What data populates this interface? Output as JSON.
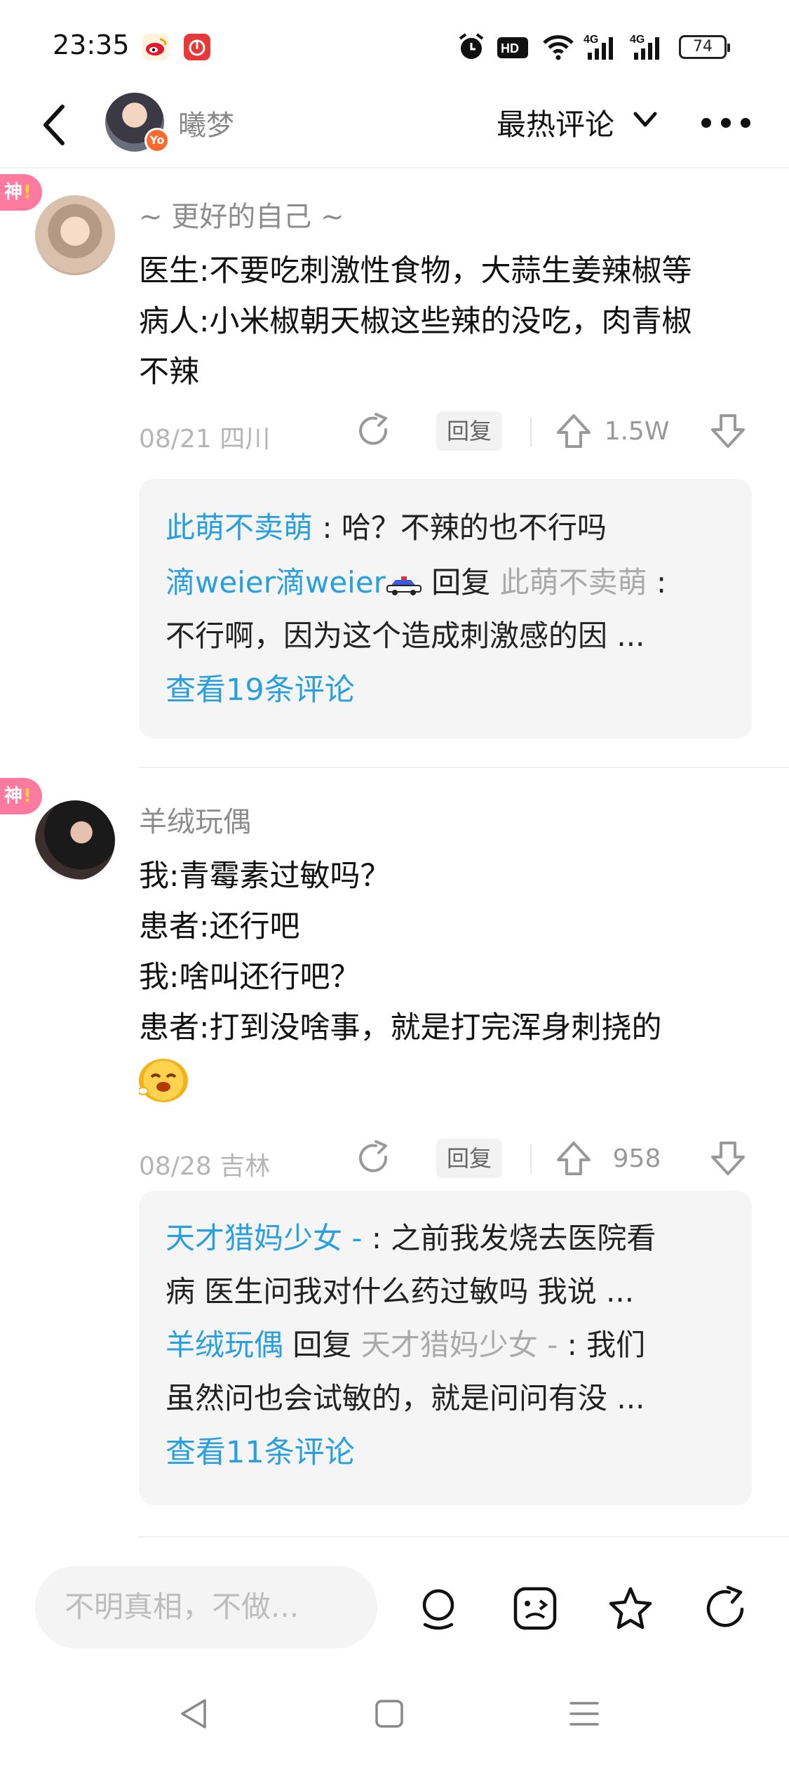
{
  "status_bar": {
    "time": "23:35",
    "battery": "74",
    "icons": [
      "weibo-icon",
      "netease-music-icon",
      "alarm-icon",
      "hd-icon",
      "wifi-icon",
      "signal-4g-icon",
      "signal-4g-icon"
    ]
  },
  "header": {
    "username": "曦梦",
    "avatar_badge": "Yo",
    "sort_label": "最热评论"
  },
  "comments": [
    {
      "badge": "神",
      "badge_mark": "!",
      "username": "~ 更好的自己 ~",
      "lines": [
        "医生:不要吃刺激性食物，大蒜生姜辣椒等",
        "病人:小米椒朝天椒这些辣的没吃，肉青椒",
        "不辣"
      ],
      "date_location": "08/21 四川",
      "reply_label": "回复",
      "likes": "1.5W",
      "replies": [
        {
          "user": "此萌不卖萌",
          "text": " : 哈？不辣的也不行吗"
        },
        {
          "user": "滴weier滴weier",
          "reply_word": " 回复 ",
          "target": "此萌不卖萌",
          "text": " :",
          "cont": "不行啊，因为这个造成刺激感的因 ..."
        }
      ],
      "view_more": "查看19条评论"
    },
    {
      "badge": "神",
      "badge_mark": "!",
      "username": "羊绒玩偶",
      "lines": [
        "我:青霉素过敏吗？",
        "患者:还行吧",
        "我:啥叫还行吧？",
        "患者:打到没啥事，就是打完浑身刺挠的"
      ],
      "date_location": "08/28 吉林",
      "reply_label": "回复",
      "likes": "958",
      "replies": [
        {
          "user": "天才猎妈少女 -",
          "text": " : 之前我发烧去医院看",
          "cont": "病 医生问我对什么药过敏吗 我说 ..."
        },
        {
          "user": "羊绒玩偶",
          "reply_word": " 回复 ",
          "target": "天才猎妈少女 -",
          "text": " :  我们",
          "cont": "虽然问也会试敏的，就是问问有没 ..."
        }
      ],
      "view_more": "查看11条评论"
    }
  ],
  "bottom_bar": {
    "input_placeholder": "不明真相，不做...",
    "icons": [
      "voice-icon",
      "emoji-icon",
      "favorite-star-icon",
      "share-icon"
    ]
  },
  "nav_bar": {
    "icons": [
      "back-triangle-icon",
      "home-square-icon",
      "menu-lines-icon"
    ]
  },
  "colors": {
    "link_blue": "#2a9fe0",
    "god_badge_pink": "#ff7aa0",
    "muted_grey": "#8c8c8c"
  }
}
